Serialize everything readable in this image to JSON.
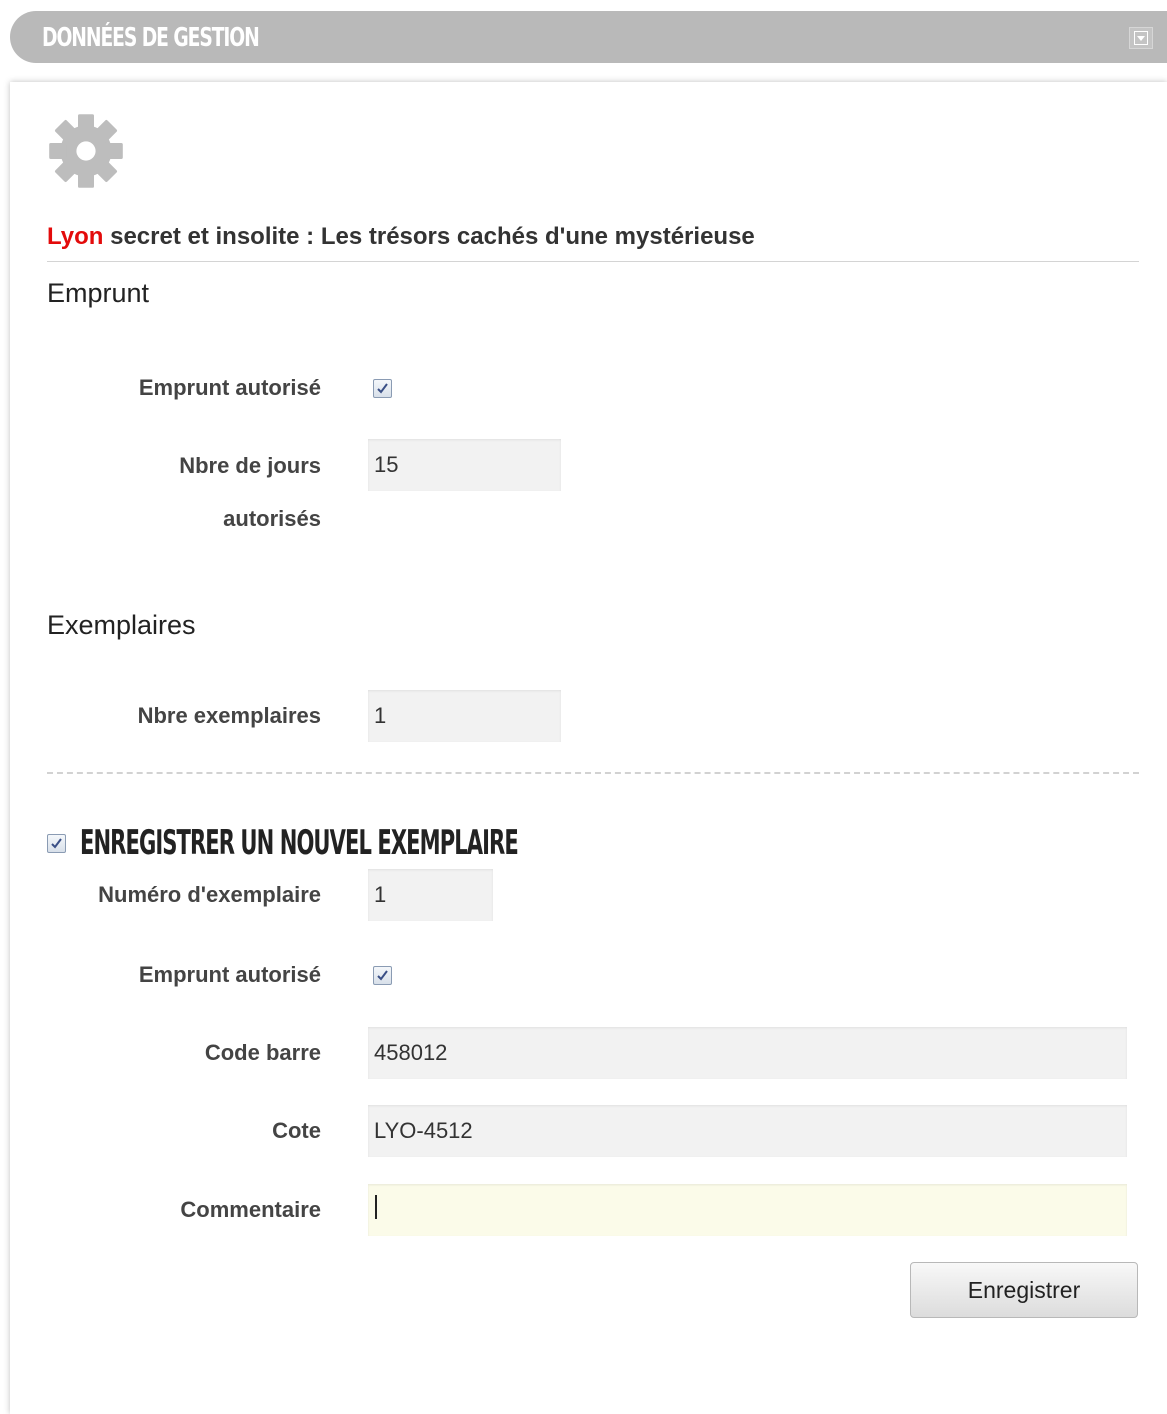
{
  "panel": {
    "title": "Données de gestion",
    "collapse_icon": "collapse-down-icon"
  },
  "header_icon": "gear-icon",
  "document": {
    "title_highlight": "Lyon",
    "title_rest": " secret et insolite : Les trésors cachés d'une mystérieuse"
  },
  "emprunt": {
    "heading": "Emprunt",
    "allowed_label": "Emprunt autorisé",
    "allowed_checked": true,
    "days_label_line1": "Nbre de jours",
    "days_label_line2": "autorisés",
    "days_value": "15"
  },
  "exemplaires": {
    "heading": "Exemplaires",
    "count_label": "Nbre exemplaires",
    "count_value": "1"
  },
  "new_copy": {
    "checked": true,
    "heading": "Enregistrer un nouvel exemplaire",
    "number_label": "Numéro d'exemplaire",
    "number_value": "1",
    "allowed_label": "Emprunt autorisé",
    "allowed_checked": true,
    "barcode_label": "Code barre",
    "barcode_value": "458012",
    "cote_label": "Cote",
    "cote_value": "LYO-4512",
    "comment_label": "Commentaire",
    "comment_value": "",
    "save_label": "Enregistrer"
  },
  "colors": {
    "highlight": "#e30b0b",
    "header_bg": "#b9b9b9",
    "focus_field_bg": "#fbfbe9"
  }
}
